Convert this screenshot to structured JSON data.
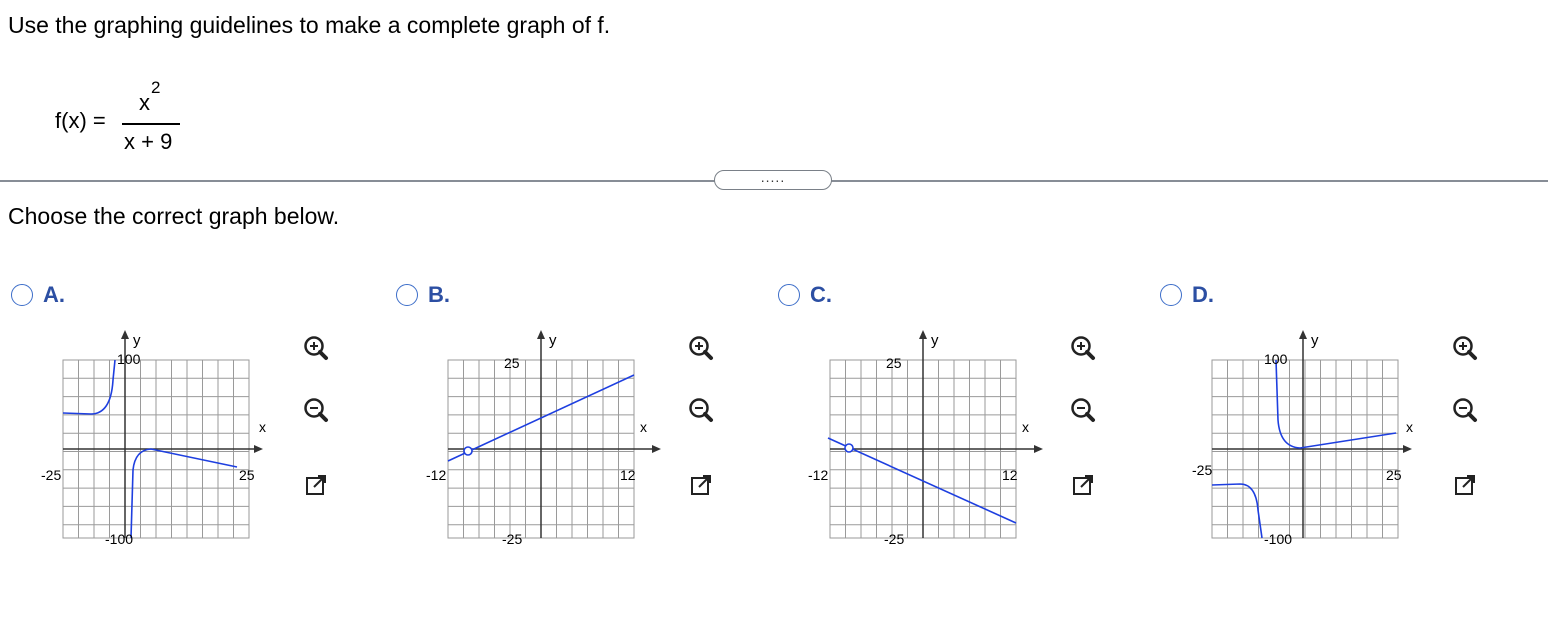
{
  "instruction": "Use the graphing guidelines to make a complete graph of f.",
  "function": {
    "lhs": "f(x) =",
    "numerator": "x",
    "exponent": "2",
    "denominator": "x + 9"
  },
  "more_button": ".....",
  "prompt": "Choose the correct graph below.",
  "accent_color": "#3d6ec9",
  "options": [
    {
      "label": "A.",
      "y_tick_top": "100",
      "y_tick_bottom": "-100",
      "x_tick_left": "-25",
      "x_tick_right": "25",
      "x_axis_label": "x",
      "y_axis_label": "y"
    },
    {
      "label": "B.",
      "y_tick_top": "25",
      "y_tick_bottom": "-25",
      "x_tick_left": "-12",
      "x_tick_right": "12",
      "x_axis_label": "x",
      "y_axis_label": "y"
    },
    {
      "label": "C.",
      "y_tick_top": "25",
      "y_tick_bottom": "-25",
      "x_tick_left": "-12",
      "x_tick_right": "12",
      "x_axis_label": "x",
      "y_axis_label": "y"
    },
    {
      "label": "D.",
      "y_tick_top": "100",
      "y_tick_bottom": "-100",
      "x_tick_left": "-25",
      "x_tick_right": "25",
      "x_axis_label": "x",
      "y_axis_label": "y"
    }
  ],
  "tools": {
    "zoom_in": "zoom-in-icon",
    "zoom_out": "zoom-out-icon",
    "popout": "popout-icon"
  }
}
